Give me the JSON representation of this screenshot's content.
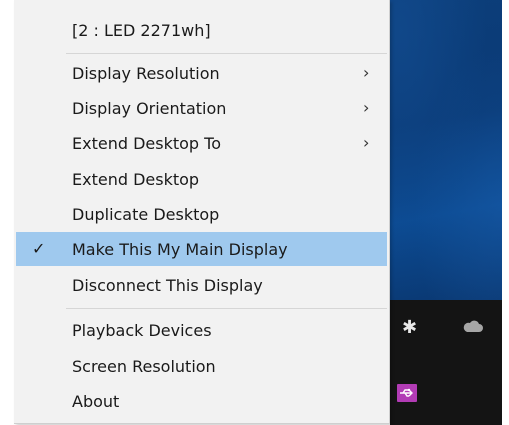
{
  "menu": {
    "header": "[2 : LED 2271wh]",
    "items": [
      {
        "label": "Display Resolution",
        "submenu": true
      },
      {
        "label": "Display Orientation",
        "submenu": true
      },
      {
        "label": "Extend Desktop To",
        "submenu": true
      },
      {
        "label": "Extend Desktop",
        "submenu": false
      },
      {
        "label": "Duplicate Desktop",
        "submenu": false
      },
      {
        "label": "Make This My Main Display",
        "submenu": false,
        "checked": true,
        "highlighted": true
      },
      {
        "label": "Disconnect This Display",
        "submenu": false
      }
    ],
    "footer_items": [
      {
        "label": "Playback Devices"
      },
      {
        "label": "Screen Resolution"
      },
      {
        "label": "About"
      }
    ],
    "chevron_glyph": "›",
    "check_glyph": "✓"
  },
  "tray": {
    "icons": [
      "bluetooth-icon",
      "onedrive-cloud-icon",
      "usb-display-icon"
    ],
    "bluetooth_glyph": "✱"
  },
  "colors": {
    "menu_bg": "#f2f2f2",
    "highlight": "#9fc9ee",
    "desktop": "#0c3e7a",
    "taskbar": "#141414",
    "usb_icon": "#b23cb5"
  }
}
